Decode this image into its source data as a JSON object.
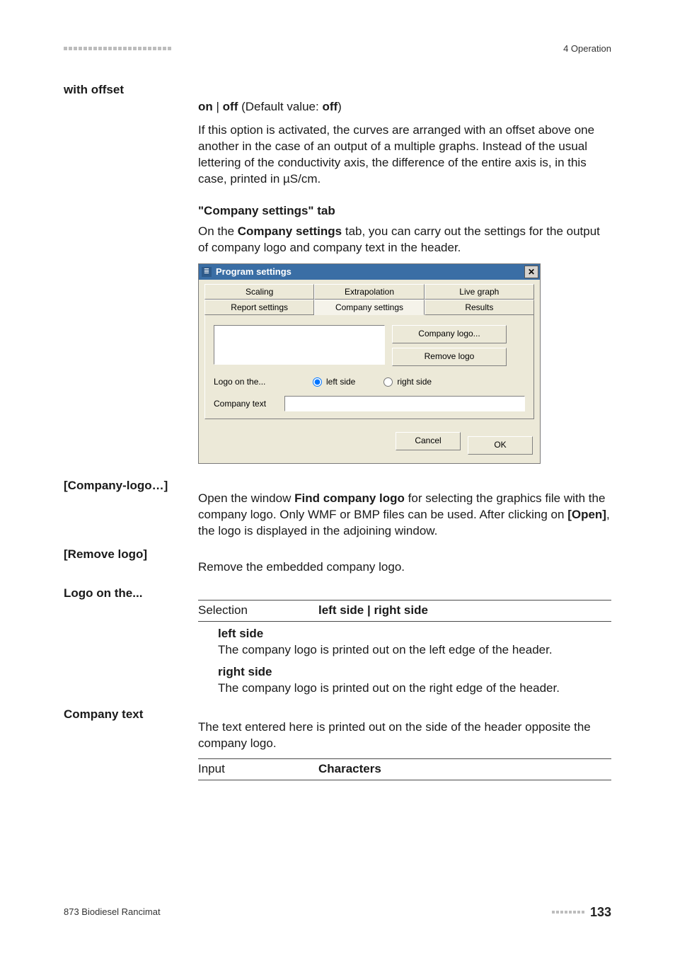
{
  "header": {
    "right_text": "4 Operation"
  },
  "with_offset": {
    "label": "with offset",
    "value_line": "on | off (Default value: off)",
    "desc": "If this option is activated, the curves are arranged with an offset above one another in the case of an output of a multiple graphs. Instead of the usual lettering of the conductivity axis, the difference of the entire axis is, in this case, printed in µS/cm."
  },
  "company_tab": {
    "heading": "\"Company settings\" tab",
    "intro_a": "On the ",
    "intro_b": "Company settings",
    "intro_c": " tab, you can carry out the settings for the output of company logo and company text in the header."
  },
  "dialog": {
    "title": "Program settings",
    "tabs_row1": [
      "Scaling",
      "Extrapolation",
      "Live graph"
    ],
    "tabs_row2": [
      "Report settings",
      "Company settings",
      "Results"
    ],
    "btn_logo": "Company logo...",
    "btn_remove": "Remove logo",
    "logo_on_label": "Logo on the...",
    "radio_left": "left side",
    "radio_right": "right side",
    "company_text_label": "Company text",
    "cancel": "Cancel",
    "ok": "OK"
  },
  "company_logo_item": {
    "label": "[Company-logo…]",
    "text_a": "Open the window ",
    "text_b": "Find company logo",
    "text_c": " for selecting the graphics file with the company logo. Only WMF or BMP files can be used. After clicking on ",
    "text_d": "[Open]",
    "text_e": ", the logo is displayed in the adjoining window."
  },
  "remove_logo_item": {
    "label": "[Remove logo]",
    "text": "Remove the embedded company logo."
  },
  "logo_on_item": {
    "label": "Logo on the...",
    "selection_label": "Selection",
    "selection_value": "left side | right side",
    "left_title": "left side",
    "left_desc": "The company logo is printed out on the left edge of the header.",
    "right_title": "right side",
    "right_desc": "The company logo is printed out on the right edge of the header."
  },
  "company_text_item": {
    "label": "Company text",
    "desc": "The text entered here is printed out on the side of the header opposite the company logo.",
    "input_label": "Input",
    "input_value": "Characters"
  },
  "footer": {
    "product": "873 Biodiesel Rancimat",
    "page": "133"
  }
}
